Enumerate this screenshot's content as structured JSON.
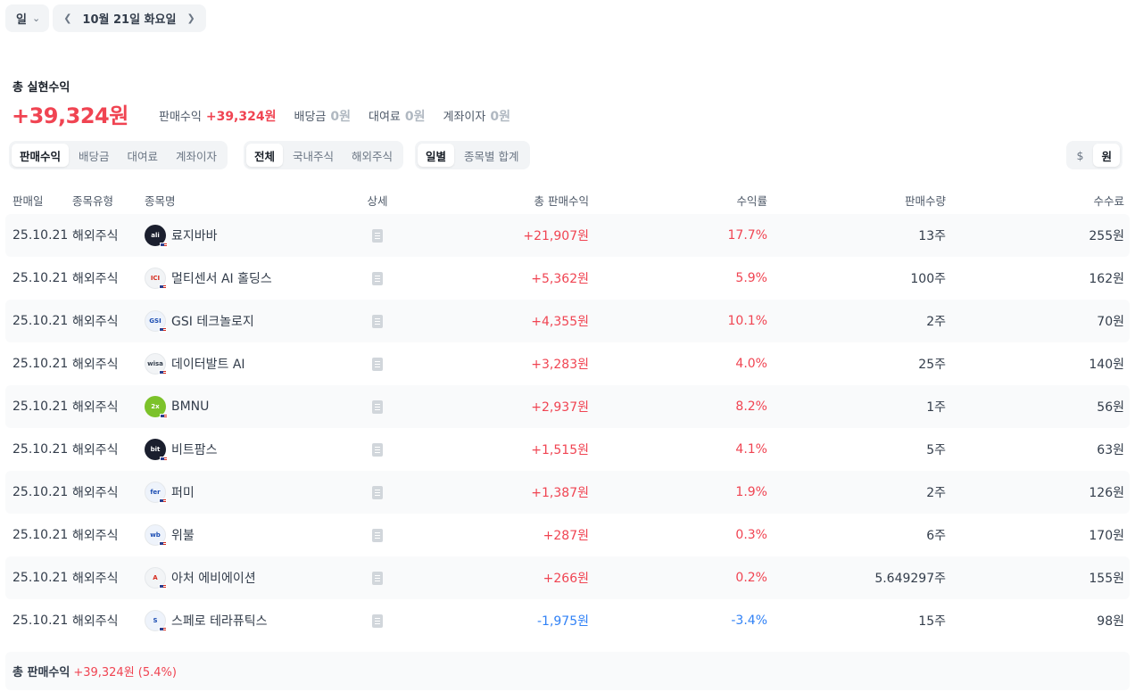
{
  "topbar": {
    "period": "일",
    "date": "10월 21일 화요일"
  },
  "summary": {
    "label": "총 실현수익",
    "value": "+39,324원",
    "breakdown": [
      {
        "label": "판매수익",
        "value": "+39,324원"
      },
      {
        "label": "배당금",
        "value": "0원"
      },
      {
        "label": "대여료",
        "value": "0원"
      },
      {
        "label": "계좌이자",
        "value": "0원"
      }
    ]
  },
  "filters": {
    "income_type": [
      "판매수익",
      "배당금",
      "대여료",
      "계좌이자"
    ],
    "market": [
      "전체",
      "국내주식",
      "해외주식"
    ],
    "grouping": [
      "일별",
      "종목별 합계"
    ],
    "currency": [
      "$",
      "원"
    ]
  },
  "table": {
    "headers": [
      "판매일",
      "종목유형",
      "종목명",
      "상세",
      "총 판매수익",
      "수익률",
      "판매수량",
      "수수료"
    ],
    "rows": [
      {
        "date": "25.10.21",
        "type": "해외주식",
        "name": "료지바바",
        "logo": "alibaba",
        "sales": "+21,907원",
        "rate": "17.7%",
        "qty": "13주",
        "fee": "255원"
      },
      {
        "date": "25.10.21",
        "type": "해외주식",
        "name": "멀티센서 AI 홀딩스",
        "logo": "ICI",
        "sales": "+5,362원",
        "rate": "5.9%",
        "qty": "100주",
        "fee": "162원"
      },
      {
        "date": "25.10.21",
        "type": "해외주식",
        "name": "GSI 테크놀로지",
        "logo": "GSI",
        "sales": "+4,355원",
        "rate": "10.1%",
        "qty": "2주",
        "fee": "70원"
      },
      {
        "date": "25.10.21",
        "type": "해외주식",
        "name": "데이터발트 AI",
        "logo": "wisa",
        "sales": "+3,283원",
        "rate": "4.0%",
        "qty": "25주",
        "fee": "140원"
      },
      {
        "date": "25.10.21",
        "type": "해외주식",
        "name": "BMNU",
        "logo": "2x",
        "sales": "+2,937원",
        "rate": "8.2%",
        "qty": "1주",
        "fee": "56원"
      },
      {
        "date": "25.10.21",
        "type": "해외주식",
        "name": "비트팜스",
        "logo": "bitfarms",
        "sales": "+1,515원",
        "rate": "4.1%",
        "qty": "5주",
        "fee": "63원"
      },
      {
        "date": "25.10.21",
        "type": "해외주식",
        "name": "퍼미",
        "logo": "fermi",
        "sales": "+1,387원",
        "rate": "1.9%",
        "qty": "2주",
        "fee": "126원"
      },
      {
        "date": "25.10.21",
        "type": "해외주식",
        "name": "위불",
        "logo": "webull",
        "sales": "+287원",
        "rate": "0.3%",
        "qty": "6주",
        "fee": "170원"
      },
      {
        "date": "25.10.21",
        "type": "해외주식",
        "name": "아처 에비에이션",
        "logo": "archer",
        "sales": "+266원",
        "rate": "0.2%",
        "qty": "5.649297주",
        "fee": "155원"
      },
      {
        "date": "25.10.21",
        "type": "해외주식",
        "name": "스페로 테라퓨틱스",
        "logo": "spero",
        "sales": "-1,975원",
        "rate": "-3.4%",
        "qty": "15주",
        "fee": "98원"
      }
    ]
  },
  "footer": {
    "label": "총 판매수익",
    "value": "+39,324원 (5.4%)"
  },
  "colors": {
    "positive": "#f04452",
    "negative": "#3182f6"
  }
}
